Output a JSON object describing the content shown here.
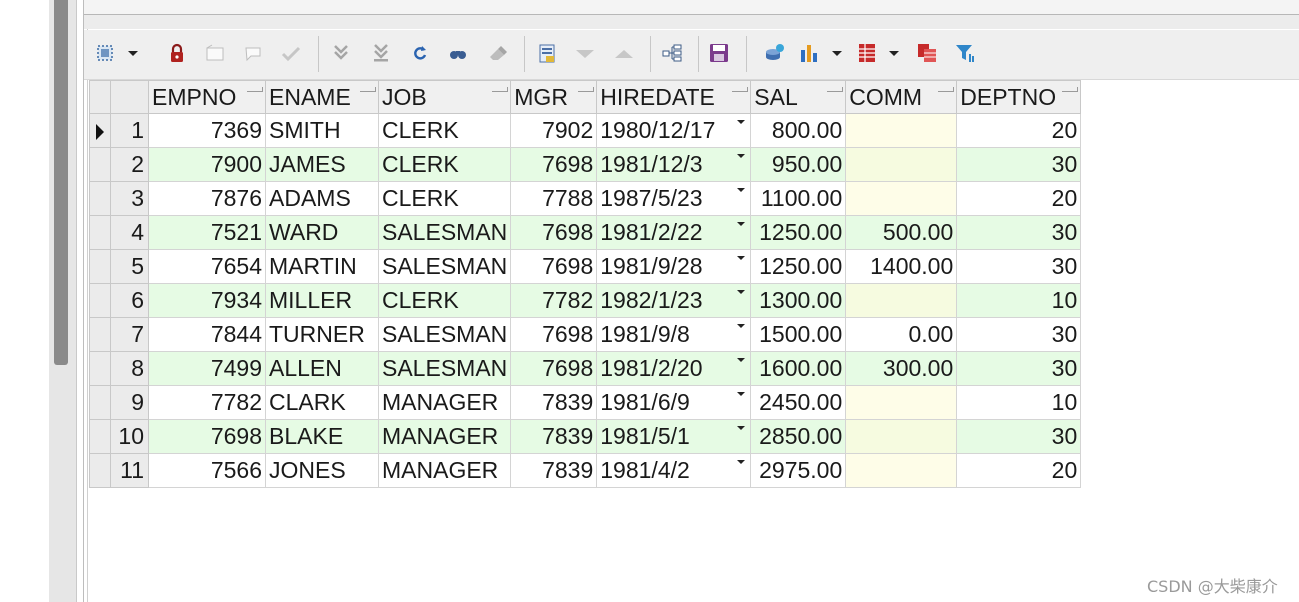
{
  "grid": {
    "columns": [
      "EMPNO",
      "ENAME",
      "JOB",
      "MGR",
      "HIREDATE",
      "SAL",
      "COMM",
      "DEPTNO"
    ],
    "rows": [
      {
        "n": "1",
        "empno": "7369",
        "ename": "SMITH",
        "job": "CLERK",
        "mgr": "7902",
        "hiredate": "1980/12/17",
        "sal": "800.00",
        "comm": "",
        "deptno": "20"
      },
      {
        "n": "2",
        "empno": "7900",
        "ename": "JAMES",
        "job": "CLERK",
        "mgr": "7698",
        "hiredate": "1981/12/3",
        "sal": "950.00",
        "comm": "",
        "deptno": "30"
      },
      {
        "n": "3",
        "empno": "7876",
        "ename": "ADAMS",
        "job": "CLERK",
        "mgr": "7788",
        "hiredate": "1987/5/23",
        "sal": "1100.00",
        "comm": "",
        "deptno": "20"
      },
      {
        "n": "4",
        "empno": "7521",
        "ename": "WARD",
        "job": "SALESMAN",
        "mgr": "7698",
        "hiredate": "1981/2/22",
        "sal": "1250.00",
        "comm": "500.00",
        "deptno": "30"
      },
      {
        "n": "5",
        "empno": "7654",
        "ename": "MARTIN",
        "job": "SALESMAN",
        "mgr": "7698",
        "hiredate": "1981/9/28",
        "sal": "1250.00",
        "comm": "1400.00",
        "deptno": "30"
      },
      {
        "n": "6",
        "empno": "7934",
        "ename": "MILLER",
        "job": "CLERK",
        "mgr": "7782",
        "hiredate": "1982/1/23",
        "sal": "1300.00",
        "comm": "",
        "deptno": "10"
      },
      {
        "n": "7",
        "empno": "7844",
        "ename": "TURNER",
        "job": "SALESMAN",
        "mgr": "7698",
        "hiredate": "1981/9/8",
        "sal": "1500.00",
        "comm": "0.00",
        "deptno": "30"
      },
      {
        "n": "8",
        "empno": "7499",
        "ename": "ALLEN",
        "job": "SALESMAN",
        "mgr": "7698",
        "hiredate": "1981/2/20",
        "sal": "1600.00",
        "comm": "300.00",
        "deptno": "30"
      },
      {
        "n": "9",
        "empno": "7782",
        "ename": "CLARK",
        "job": "MANAGER",
        "mgr": "7839",
        "hiredate": "1981/6/9",
        "sal": "2450.00",
        "comm": "",
        "deptno": "10"
      },
      {
        "n": "10",
        "empno": "7698",
        "ename": "BLAKE",
        "job": "MANAGER",
        "mgr": "7839",
        "hiredate": "1981/5/1",
        "sal": "2850.00",
        "comm": "",
        "deptno": "30"
      },
      {
        "n": "11",
        "empno": "7566",
        "ename": "JONES",
        "job": "MANAGER",
        "mgr": "7839",
        "hiredate": "1981/4/2",
        "sal": "2975.00",
        "comm": "",
        "deptno": "20"
      }
    ]
  },
  "toolbar": {
    "icons": [
      "select-mode-icon",
      "lock-icon",
      "insert-record-icon",
      "delete-record-icon",
      "post-changes-icon",
      "next-record-icon",
      "last-record-icon",
      "refresh-icon",
      "find-icon",
      "clear-icon",
      "query-by-example-icon",
      "sort-descending-icon",
      "sort-ascending-icon",
      "tree-view-icon",
      "save-icon",
      "export-icon",
      "chart-icon",
      "table-view-icon",
      "form-view-icon",
      "filter-icon"
    ]
  },
  "watermark": "CSDN @大柴康介"
}
